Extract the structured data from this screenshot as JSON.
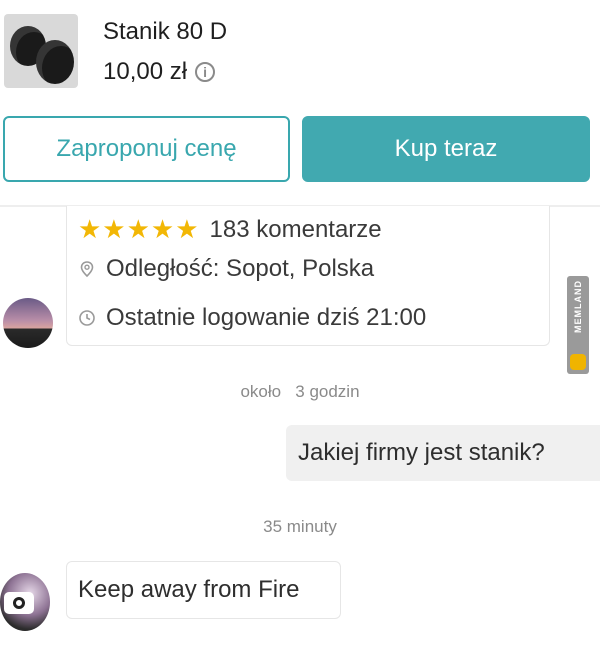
{
  "product": {
    "title": "Stanik 80 D",
    "price": "10,00 zł",
    "thumbnail_alt_icon": "product-photo"
  },
  "actions": {
    "offer_label": "Zaproponuj cenę",
    "buy_label": "Kup teraz"
  },
  "seller": {
    "stars": "★★★★★",
    "rating_count": 5,
    "reviews": "183 komentarze",
    "distance": "Odległość: Sopot, Polska",
    "last_login": "Ostatnie logowanie dziś 21:00"
  },
  "chat": {
    "time_1": "około   3 godzin",
    "message_out": "Jakiej firmy jest stanik?",
    "time_2": "35 minuty",
    "message_in": "Keep away from Fire"
  },
  "colors": {
    "accent": "#41a9b0",
    "star": "#f2b705"
  }
}
